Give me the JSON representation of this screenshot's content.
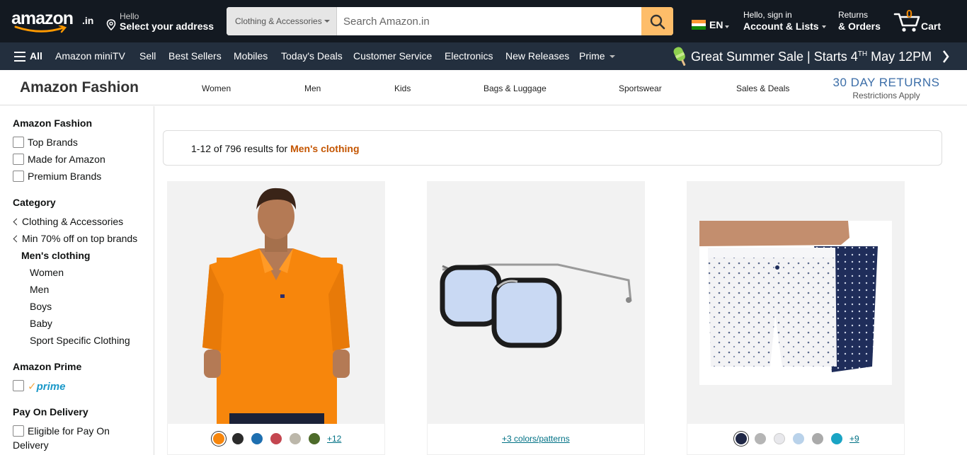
{
  "header": {
    "logo_text": "amazon",
    "logo_tld": ".in",
    "address_hello": "Hello",
    "address_label": "Select your address",
    "search_category": "Clothing & Accessories",
    "search_placeholder": "Search Amazon.in",
    "language": "EN",
    "account_greeting": "Hello, sign in",
    "account_label": "Account & Lists",
    "returns_label": "Returns",
    "orders_label": "& Orders",
    "cart_count": "0",
    "cart_label": "Cart"
  },
  "nav": {
    "all_label": "All",
    "items": [
      "Amazon miniTV",
      "Sell",
      "Best Sellers",
      "Mobiles",
      "Today's Deals",
      "Customer Service",
      "Electronics",
      "New Releases",
      "Prime"
    ],
    "promo_text": "Great Summer Sale | Starts 4",
    "promo_sup": "TH",
    "promo_tail": " May 12PM"
  },
  "fashion_nav": {
    "brand": "Amazon Fashion",
    "links": [
      "Women",
      "Men",
      "Kids",
      "Bags & Luggage",
      "Sportswear",
      "Sales & Deals"
    ],
    "returns_title": "30 DAY RETURNS",
    "returns_note": "Restrictions Apply"
  },
  "sidebar": {
    "section_fashion": "Amazon Fashion",
    "fashion_filters": [
      "Top Brands",
      "Made for Amazon",
      "Premium Brands"
    ],
    "section_category": "Category",
    "back_categories": [
      "Clothing & Accessories",
      "Min 70% off on top brands"
    ],
    "current_category": "Men's clothing",
    "sub_categories": [
      "Women",
      "Men",
      "Boys",
      "Baby",
      "Sport Specific Clothing"
    ],
    "section_prime": "Amazon Prime",
    "prime_label": "prime",
    "section_pod": "Pay On Delivery",
    "pod_line1": "Eligible for Pay On",
    "pod_line2": "Delivery"
  },
  "results": {
    "prefix": "1-12 of 796 results for ",
    "query": "Men's clothing"
  },
  "products": [
    {
      "image": "orange-polo-tshirt",
      "swatches": [
        "#f7860c",
        "#2b2b2b",
        "#1e6fb0",
        "#c44650",
        "#bcb7aa",
        "#4d6b2a"
      ],
      "more": "+12"
    },
    {
      "image": "aviator-sunglasses",
      "swatches": [],
      "more": "+3 colors/patterns"
    },
    {
      "image": "printed-boxer-shorts",
      "swatches": [
        "#1f2746",
        "#b5b5b5",
        "#e8e8ec",
        "#b9d2ea",
        "#aaaaaa",
        "#1aa4c4"
      ],
      "more": "+9"
    }
  ]
}
